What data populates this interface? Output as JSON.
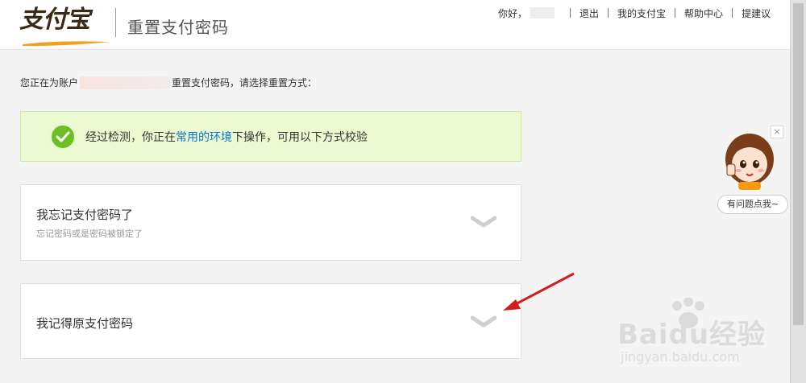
{
  "header": {
    "logo_text": "支付宝",
    "page_title": "重置支付密码",
    "nav": {
      "greeting": "你好，",
      "logout": "退出",
      "my_alipay": "我的支付宝",
      "help": "帮助中心",
      "suggest": "提建议"
    }
  },
  "account_line": {
    "prefix": "您正在为账户",
    "suffix": "重置支付密码，请选择重置方式："
  },
  "notice": {
    "before": "经过检测，你正在",
    "link": "常用的环境",
    "after": "下操作，可用以下方式校验"
  },
  "options": [
    {
      "title": "我忘记支付密码了",
      "subtitle": "忘记密码或是密码被锁定了"
    },
    {
      "title": "我记得原支付密码"
    }
  ],
  "mascot": {
    "close": "×",
    "bubble": "有问题点我~"
  },
  "watermark": {
    "brand": "Baidu经验",
    "url": "jingyan.baidu.com"
  },
  "colors": {
    "notice_bg": "#ebfad1",
    "check_green": "#6bbf23",
    "link_blue": "#0a74c7",
    "arrow_red": "#d11f1f"
  }
}
